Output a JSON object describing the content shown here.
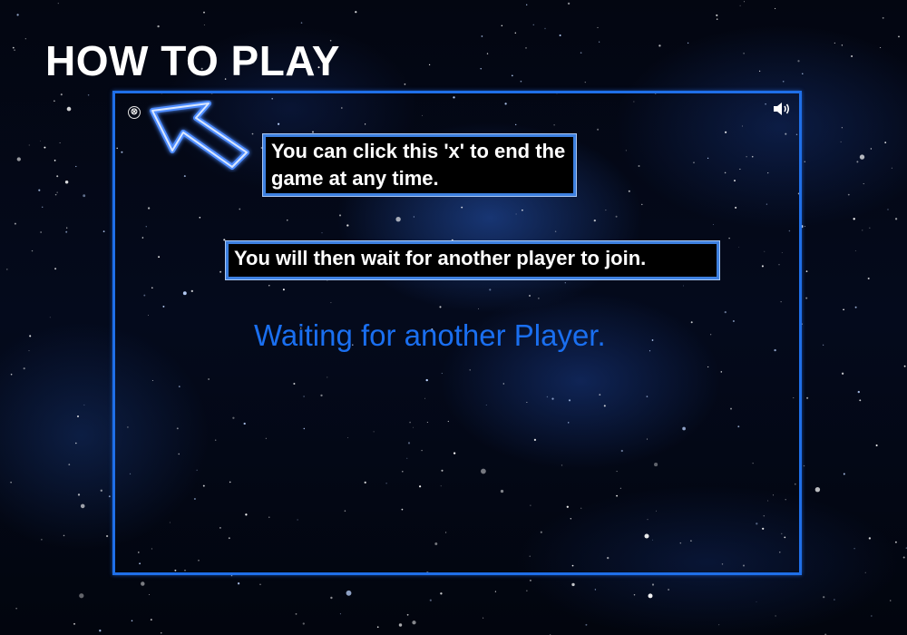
{
  "title": "HOW TO PLAY",
  "close_button": {
    "glyph": "⊗",
    "icon": "close-icon"
  },
  "sound_button": {
    "icon": "speaker-icon"
  },
  "callouts": {
    "close_hint": "You can click this 'x' to end the game at any time.",
    "wait_hint": "You will then wait for another player to join."
  },
  "status_text": "Waiting for another Player.",
  "colors": {
    "frame_border": "#1f6fe8",
    "callout_border": "#3d80e0",
    "status_text": "#1a6ff0",
    "arrow_glow": "#4f8dff",
    "background": "#02040c"
  }
}
